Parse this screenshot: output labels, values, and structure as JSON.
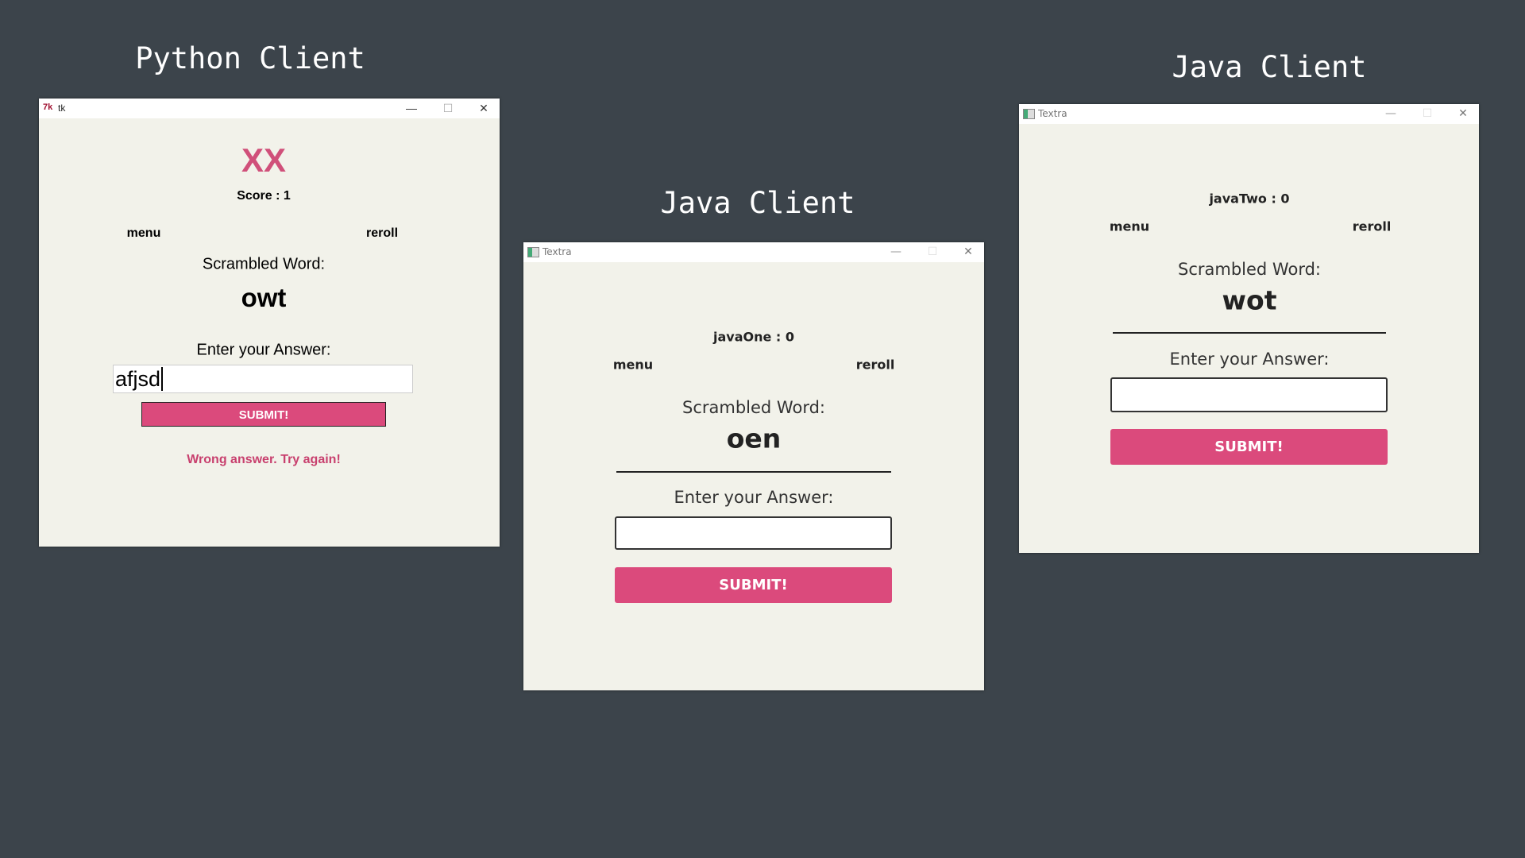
{
  "labels": {
    "python": "Python Client",
    "java_middle": "Java Client",
    "java_right": "Java Client"
  },
  "python_window": {
    "title": "tk",
    "result": "XX",
    "score": "Score : 1",
    "menu": "menu",
    "reroll": "reroll",
    "scrambled_label": "Scrambled Word:",
    "scrambled_word": "owt",
    "answer_label": "Enter your Answer:",
    "answer_value": "afjsd",
    "submit": "SUBMIT!",
    "message": "Wrong answer. Try again!"
  },
  "java_one_window": {
    "title": "Textra",
    "score": "javaOne : 0",
    "menu": "menu",
    "reroll": "reroll",
    "scrambled_label": "Scrambled Word:",
    "scrambled_word": "oen",
    "answer_label": "Enter your Answer:",
    "answer_value": "",
    "submit": "SUBMIT!"
  },
  "java_two_window": {
    "title": "Textra",
    "score": "javaTwo : 0",
    "menu": "menu",
    "reroll": "reroll",
    "scrambled_label": "Scrambled Word:",
    "scrambled_word": "wot",
    "answer_label": "Enter your Answer:",
    "answer_value": "",
    "submit": "SUBMIT!"
  },
  "window_controls": {
    "minimize": "—",
    "maximize": "☐",
    "close": "✕"
  },
  "colors": {
    "accent": "#db4a7c",
    "background": "#3c444b",
    "window": "#f2f2ea"
  }
}
